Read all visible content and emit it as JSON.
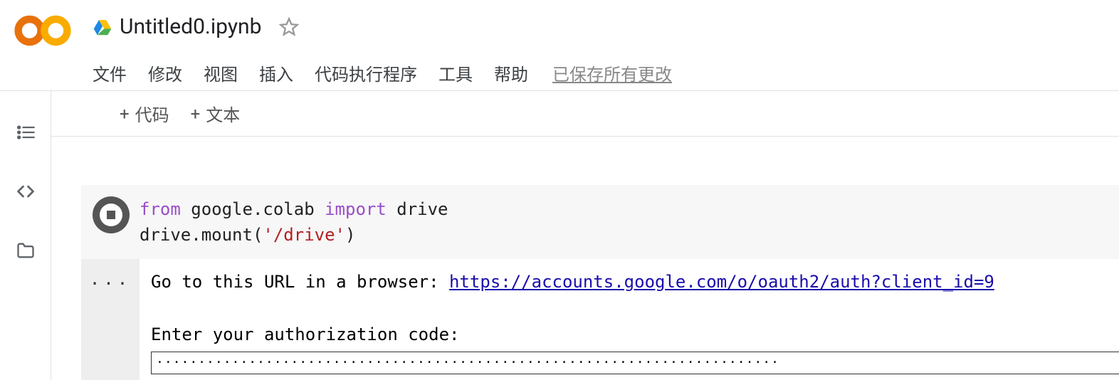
{
  "header": {
    "title": "Untitled0.ipynb",
    "menu": {
      "file": "文件",
      "edit": "修改",
      "view": "视图",
      "insert": "插入",
      "runtime": "代码执行程序",
      "tools": "工具",
      "help": "帮助"
    },
    "saved_status": "已保存所有更改"
  },
  "toolbar": {
    "code_label": "代码",
    "text_label": "文本",
    "plus": "+"
  },
  "side": {
    "toc": "toc",
    "code": "code",
    "files": "files"
  },
  "cell": {
    "code_tokens": {
      "from": "from",
      "module": "google.colab",
      "import": "import",
      "name": "drive",
      "mount_call": "drive.mount(",
      "mount_arg": "'/drive'",
      "mount_end": ")"
    }
  },
  "output": {
    "gutter": "...",
    "prompt_prefix": "Go to this URL in a browser: ",
    "url": "https://accounts.google.com/o/oauth2/auth?client_id=9",
    "enter_code": "Enter your authorization code:",
    "input_value": "··········································································"
  }
}
